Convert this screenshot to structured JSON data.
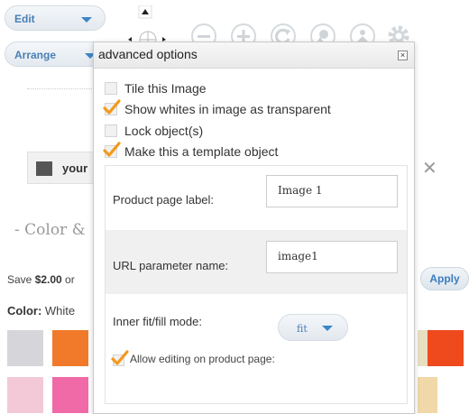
{
  "toolbar": {
    "edit_label": "Edit",
    "arrange_label": "Arrange"
  },
  "icons": {
    "nudge": "nudge-pad-icon",
    "zoom_out": "minus-icon",
    "zoom_in": "plus-icon",
    "rotate": "rotate-icon",
    "image": "image-icon",
    "person": "person-icon",
    "settings": "gear-icon"
  },
  "background": {
    "textbox_label": "your",
    "section_title": "- Color &",
    "save_prefix": "Save ",
    "save_amount": "$2.00",
    "save_suffix": " or",
    "apply_label": "Apply",
    "color_label": "Color:",
    "color_value": " White",
    "swatches": [
      "#d6d6da",
      "#f07a2a",
      "#e2d5b6",
      "#f4c9d7",
      "#f06aa8"
    ]
  },
  "dialog": {
    "title": "advanced options",
    "close_glyph": "×",
    "options": [
      {
        "label": "Tile this Image",
        "checked": false
      },
      {
        "label": "Show whites in image as transparent",
        "checked": true
      },
      {
        "label": "Lock object(s)",
        "checked": false
      },
      {
        "label": "Make this a template object",
        "checked": true
      }
    ],
    "product_page_label": {
      "label": "Product page label:",
      "value": "Image 1"
    },
    "url_parameter": {
      "label": "URL parameter name:",
      "value": "image1"
    },
    "fit_mode": {
      "label": "Inner fit/fill mode:",
      "value": "fit"
    },
    "allow_editing": {
      "label": "Allow editing on product page:",
      "checked": true
    }
  },
  "colors": {
    "accent": "#3c86c9",
    "check": "#f39a1c"
  }
}
